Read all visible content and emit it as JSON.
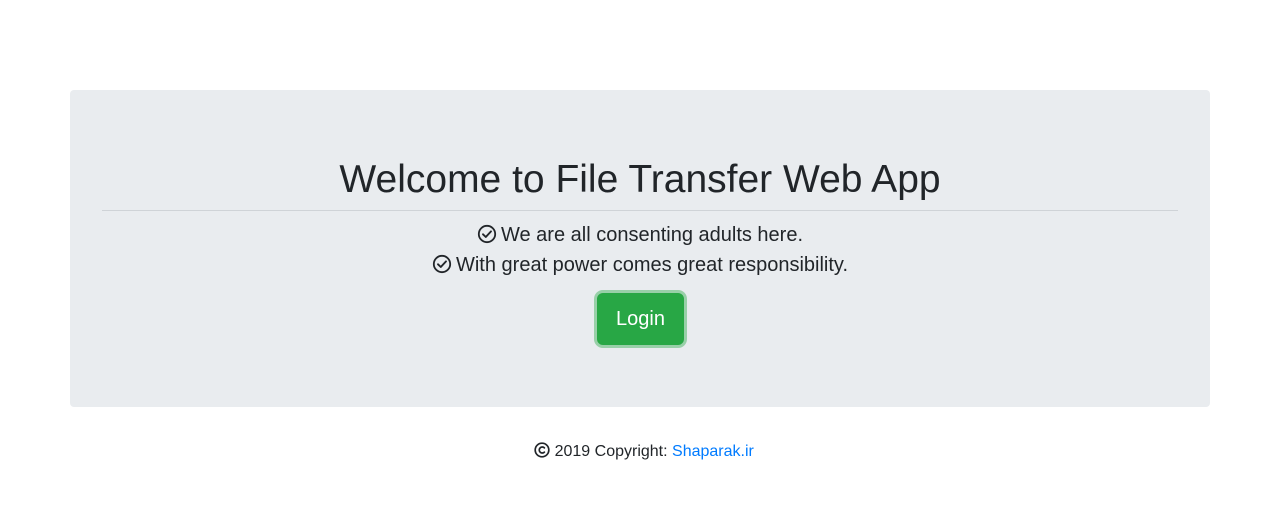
{
  "jumbotron": {
    "title": "Welcome to File Transfer Web App",
    "lines": [
      {
        "icon": "check-circle-icon",
        "text": "We are all consenting adults here."
      },
      {
        "icon": "check-circle-icon",
        "text": "With great power comes great responsibility."
      }
    ],
    "login_label": "Login"
  },
  "footer": {
    "icon": "copyright-icon",
    "text": " 2019 Copyright: ",
    "link_text": "Shaparak.ir"
  },
  "colors": {
    "panel_bg": "#e9ecef",
    "button_bg": "#28a745",
    "link": "#007bff",
    "text": "#212529"
  }
}
